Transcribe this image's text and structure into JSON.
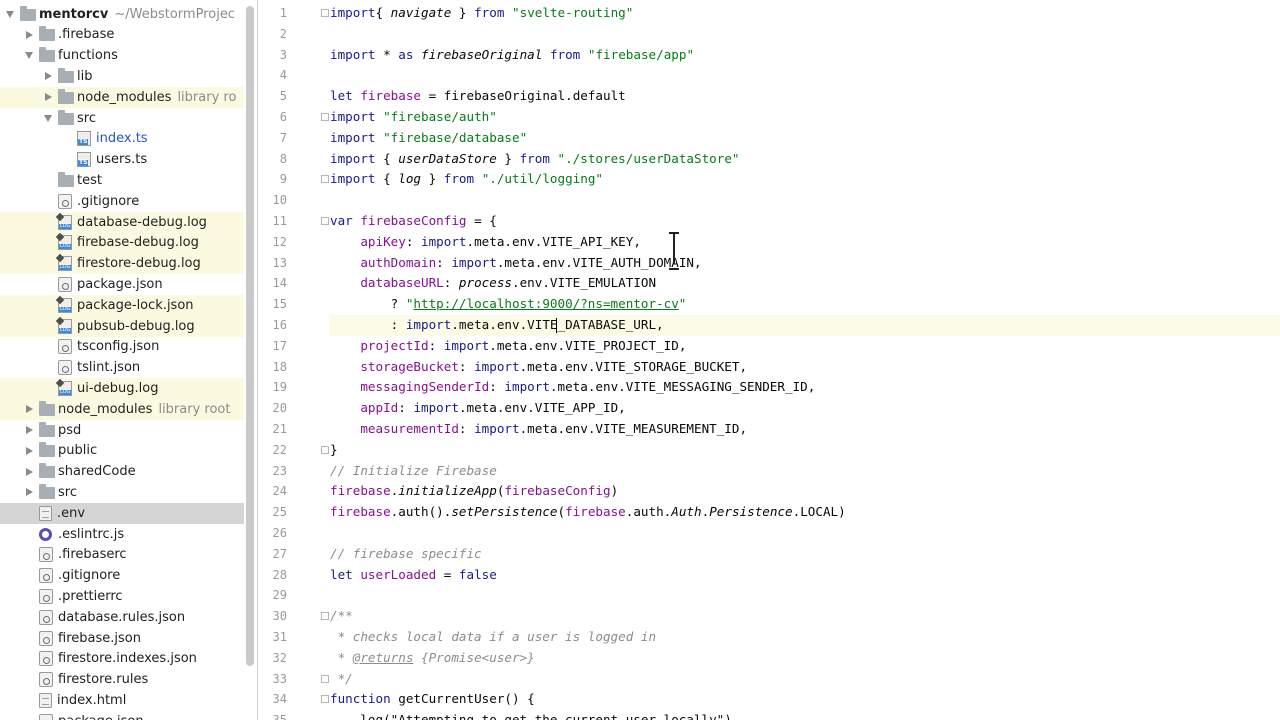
{
  "tree": {
    "items": [
      {
        "label": "mentorcv",
        "suffix": "~/WebstormProjec",
        "kind": "folder",
        "arrow": "down",
        "depth": 0,
        "bold": true
      },
      {
        "label": ".firebase",
        "kind": "folder",
        "arrow": "right",
        "depth": 1
      },
      {
        "label": "functions",
        "kind": "folder",
        "arrow": "down",
        "depth": 1
      },
      {
        "label": "lib",
        "kind": "folder",
        "arrow": "right",
        "depth": 2
      },
      {
        "label": "node_modules",
        "suffix": "library ro",
        "kind": "folder",
        "arrow": "right",
        "depth": 2,
        "ignored": true
      },
      {
        "label": "src",
        "kind": "folder",
        "arrow": "down",
        "depth": 2
      },
      {
        "label": "index.ts",
        "kind": "ts",
        "arrow": "none",
        "depth": 3,
        "blue": true
      },
      {
        "label": "users.ts",
        "kind": "ts",
        "arrow": "none",
        "depth": 3
      },
      {
        "label": "test",
        "kind": "folder",
        "arrow": "none",
        "depth": 2
      },
      {
        "label": ".gitignore",
        "kind": "config",
        "arrow": "none",
        "depth": 2
      },
      {
        "label": "database-debug.log",
        "kind": "log",
        "arrow": "none",
        "depth": 2,
        "ignored": true
      },
      {
        "label": "firebase-debug.log",
        "kind": "log",
        "arrow": "none",
        "depth": 2,
        "ignored": true
      },
      {
        "label": "firestore-debug.log",
        "kind": "log",
        "arrow": "none",
        "depth": 2,
        "ignored": true
      },
      {
        "label": "package.json",
        "kind": "config",
        "arrow": "none",
        "depth": 2
      },
      {
        "label": "package-lock.json",
        "kind": "log",
        "arrow": "none",
        "depth": 2,
        "ignored": true
      },
      {
        "label": "pubsub-debug.log",
        "kind": "log",
        "arrow": "none",
        "depth": 2,
        "ignored": true
      },
      {
        "label": "tsconfig.json",
        "kind": "config",
        "arrow": "none",
        "depth": 2
      },
      {
        "label": "tslint.json",
        "kind": "config",
        "arrow": "none",
        "depth": 2
      },
      {
        "label": "ui-debug.log",
        "kind": "log",
        "arrow": "none",
        "depth": 2,
        "ignored": true
      },
      {
        "label": "node_modules",
        "suffix": "library root",
        "kind": "folder",
        "arrow": "right",
        "depth": 1,
        "ignored": true
      },
      {
        "label": "psd",
        "kind": "folder",
        "arrow": "right",
        "depth": 1
      },
      {
        "label": "public",
        "kind": "folder",
        "arrow": "right",
        "depth": 1
      },
      {
        "label": "sharedCode",
        "kind": "folder",
        "arrow": "right",
        "depth": 1
      },
      {
        "label": "src",
        "kind": "folder",
        "arrow": "right",
        "depth": 1
      },
      {
        "label": ".env",
        "kind": "file",
        "arrow": "none",
        "depth": 1,
        "selected": true
      },
      {
        "label": ".eslintrc.js",
        "kind": "eslint",
        "arrow": "none",
        "depth": 1
      },
      {
        "label": ".firebaserc",
        "kind": "config",
        "arrow": "none",
        "depth": 1
      },
      {
        "label": ".gitignore",
        "kind": "config",
        "arrow": "none",
        "depth": 1
      },
      {
        "label": ".prettierrc",
        "kind": "config",
        "arrow": "none",
        "depth": 1
      },
      {
        "label": "database.rules.json",
        "kind": "config",
        "arrow": "none",
        "depth": 1
      },
      {
        "label": "firebase.json",
        "kind": "config",
        "arrow": "none",
        "depth": 1
      },
      {
        "label": "firestore.indexes.json",
        "kind": "config",
        "arrow": "none",
        "depth": 1
      },
      {
        "label": "firestore.rules",
        "kind": "config",
        "arrow": "none",
        "depth": 1
      },
      {
        "label": "index.html",
        "kind": "file",
        "arrow": "none",
        "depth": 1
      },
      {
        "label": "package.json",
        "kind": "config",
        "arrow": "none",
        "depth": 1
      }
    ]
  },
  "editor": {
    "current_line": 16,
    "lines": [
      {
        "n": "1",
        "fold": true,
        "tokens": [
          [
            "kw",
            "import"
          ],
          [
            "",
            "{ "
          ],
          [
            "ital",
            "navigate"
          ],
          [
            "",
            " } "
          ],
          [
            "kw",
            "from"
          ],
          [
            "",
            " "
          ],
          [
            "str",
            "\"svelte-routing\""
          ]
        ]
      },
      {
        "n": "2",
        "tokens": []
      },
      {
        "n": "3",
        "tokens": [
          [
            "kw",
            "import"
          ],
          [
            "",
            " * "
          ],
          [
            "kw",
            "as"
          ],
          [
            "",
            " "
          ],
          [
            "ital",
            "firebaseOriginal"
          ],
          [
            "",
            " "
          ],
          [
            "kw",
            "from"
          ],
          [
            "",
            " "
          ],
          [
            "str",
            "\"firebase/app\""
          ]
        ]
      },
      {
        "n": "4",
        "tokens": []
      },
      {
        "n": "5",
        "tokens": [
          [
            "kw",
            "let"
          ],
          [
            "",
            " "
          ],
          [
            "prop",
            "firebase"
          ],
          [
            "",
            " = "
          ],
          [
            "",
            "firebaseOriginal"
          ],
          [
            "",
            "."
          ],
          [
            "",
            "default"
          ]
        ]
      },
      {
        "n": "6",
        "fold": true,
        "tokens": [
          [
            "kw",
            "import"
          ],
          [
            "",
            " "
          ],
          [
            "str",
            "\"firebase/auth\""
          ]
        ]
      },
      {
        "n": "7",
        "tokens": [
          [
            "kw",
            "import"
          ],
          [
            "",
            " "
          ],
          [
            "str",
            "\"firebase/database\""
          ]
        ]
      },
      {
        "n": "8",
        "tokens": [
          [
            "kw",
            "import"
          ],
          [
            "",
            " { "
          ],
          [
            "ital",
            "userDataStore"
          ],
          [
            "",
            " } "
          ],
          [
            "kw",
            "from"
          ],
          [
            "",
            " "
          ],
          [
            "str",
            "\"./stores/userDataStore\""
          ]
        ]
      },
      {
        "n": "9",
        "fold": true,
        "tokens": [
          [
            "kw",
            "import"
          ],
          [
            "",
            " { "
          ],
          [
            "ital",
            "log"
          ],
          [
            "",
            " } "
          ],
          [
            "kw",
            "from"
          ],
          [
            "",
            " "
          ],
          [
            "str",
            "\"./util/logging\""
          ]
        ]
      },
      {
        "n": "10",
        "tokens": []
      },
      {
        "n": "11",
        "fold": true,
        "tokens": [
          [
            "kw",
            "var"
          ],
          [
            "",
            " "
          ],
          [
            "prop",
            "firebaseConfig"
          ],
          [
            "",
            " = {"
          ]
        ]
      },
      {
        "n": "12",
        "tokens": [
          [
            "",
            "    "
          ],
          [
            "prop",
            "apiKey"
          ],
          [
            "",
            ": "
          ],
          [
            "kw",
            "import"
          ],
          [
            "",
            ".meta.env.VITE_API_KEY,"
          ]
        ]
      },
      {
        "n": "13",
        "tokens": [
          [
            "",
            "    "
          ],
          [
            "prop",
            "authDomain"
          ],
          [
            "",
            ": "
          ],
          [
            "kw",
            "import"
          ],
          [
            "",
            ".meta.env.VITE_AUTH_DOMAIN,"
          ]
        ]
      },
      {
        "n": "14",
        "tokens": [
          [
            "",
            "    "
          ],
          [
            "prop",
            "databaseURL"
          ],
          [
            "",
            ": "
          ],
          [
            "ital",
            "process"
          ],
          [
            "",
            ".env.VITE_EMULATION"
          ]
        ]
      },
      {
        "n": "15",
        "tokens": [
          [
            "",
            "        ? "
          ],
          [
            "str",
            "\""
          ],
          [
            "url",
            "http://localhost:9000/?ns=mentor-cv"
          ],
          [
            "str",
            "\""
          ]
        ]
      },
      {
        "n": "16",
        "caret": true,
        "tokens": [
          [
            "",
            "        : "
          ],
          [
            "kw",
            "import"
          ],
          [
            "",
            ".meta.env.VITE"
          ],
          [
            "caret",
            ""
          ],
          [
            "",
            "_DATABASE_URL,"
          ]
        ]
      },
      {
        "n": "17",
        "tokens": [
          [
            "",
            "    "
          ],
          [
            "prop",
            "projectId"
          ],
          [
            "",
            ": "
          ],
          [
            "kw",
            "import"
          ],
          [
            "",
            ".meta.env.VITE_PROJECT_ID,"
          ]
        ]
      },
      {
        "n": "18",
        "tokens": [
          [
            "",
            "    "
          ],
          [
            "prop",
            "storageBucket"
          ],
          [
            "",
            ": "
          ],
          [
            "kw",
            "import"
          ],
          [
            "",
            ".meta.env.VITE_STORAGE_BUCKET,"
          ]
        ]
      },
      {
        "n": "19",
        "tokens": [
          [
            "",
            "    "
          ],
          [
            "prop",
            "messagingSenderId"
          ],
          [
            "",
            ": "
          ],
          [
            "kw",
            "import"
          ],
          [
            "",
            ".meta.env.VITE_MESSAGING_SENDER_ID,"
          ]
        ]
      },
      {
        "n": "20",
        "tokens": [
          [
            "",
            "    "
          ],
          [
            "prop",
            "appId"
          ],
          [
            "",
            ": "
          ],
          [
            "kw",
            "import"
          ],
          [
            "",
            ".meta.env.VITE_APP_ID,"
          ]
        ]
      },
      {
        "n": "21",
        "tokens": [
          [
            "",
            "    "
          ],
          [
            "prop",
            "measurementId"
          ],
          [
            "",
            ": "
          ],
          [
            "kw",
            "import"
          ],
          [
            "",
            ".meta.env.VITE_MEASUREMENT_ID,"
          ]
        ]
      },
      {
        "n": "22",
        "fold": true,
        "tokens": [
          [
            "",
            "}"
          ]
        ]
      },
      {
        "n": "23",
        "tokens": [
          [
            "cmt",
            "// Initialize Firebase"
          ]
        ]
      },
      {
        "n": "24",
        "tokens": [
          [
            "prop",
            "firebase"
          ],
          [
            "",
            "."
          ],
          [
            "ital",
            "initializeApp"
          ],
          [
            "",
            "("
          ],
          [
            "prop",
            "firebaseConfig"
          ],
          [
            "",
            ")"
          ]
        ]
      },
      {
        "n": "25",
        "tokens": [
          [
            "prop",
            "firebase"
          ],
          [
            "",
            ".auth()."
          ],
          [
            "ital",
            "setPersistence"
          ],
          [
            "",
            "("
          ],
          [
            "prop",
            "firebase"
          ],
          [
            "",
            ".auth."
          ],
          [
            "ital",
            "Auth"
          ],
          [
            "",
            "."
          ],
          [
            "ital",
            "Persistence"
          ],
          [
            "",
            ".LOCAL)"
          ]
        ]
      },
      {
        "n": "26",
        "tokens": []
      },
      {
        "n": "27",
        "tokens": [
          [
            "cmt",
            "// firebase specific"
          ]
        ]
      },
      {
        "n": "28",
        "tokens": [
          [
            "kw",
            "let"
          ],
          [
            "",
            " "
          ],
          [
            "prop",
            "userLoaded"
          ],
          [
            "",
            " = "
          ],
          [
            "kw",
            "false"
          ]
        ]
      },
      {
        "n": "29",
        "tokens": []
      },
      {
        "n": "30",
        "fold": true,
        "tokens": [
          [
            "cmt",
            "/**"
          ]
        ]
      },
      {
        "n": "31",
        "tokens": [
          [
            "cmt",
            " * checks local data if a user is logged in"
          ]
        ]
      },
      {
        "n": "32",
        "tokens": [
          [
            "cmt",
            " * "
          ],
          [
            "jsdoc",
            "@returns"
          ],
          [
            "cmt",
            " {Promise<user>}"
          ]
        ]
      },
      {
        "n": "33",
        "fold": true,
        "tokens": [
          [
            "cmt",
            " */"
          ]
        ]
      },
      {
        "n": "34",
        "fold": true,
        "tokens": [
          [
            "kw",
            "function"
          ],
          [
            "",
            " "
          ],
          [
            "",
            "getCurrentUser"
          ],
          [
            "",
            "() {"
          ]
        ]
      },
      {
        "n": "35",
        "tokens": [
          [
            "",
            "    log(\"Attempting to get the current user locally\")"
          ]
        ]
      }
    ]
  }
}
